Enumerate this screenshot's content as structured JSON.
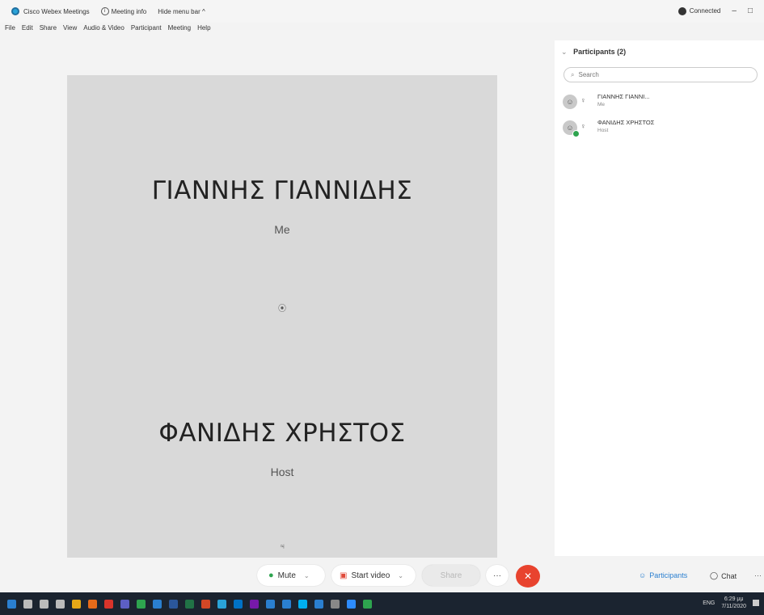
{
  "window": {
    "app_title": "Cisco Webex Meetings",
    "meeting_info": "Meeting info",
    "hide_menu": "Hide menu bar ^",
    "connection_status": "Connected",
    "minimize": "–",
    "maximize": "□"
  },
  "menu": [
    "File",
    "Edit",
    "Share",
    "View",
    "Audio & Video",
    "Participant",
    "Meeting",
    "Help"
  ],
  "stage": {
    "participants": [
      {
        "name": "ΓΙΑΝΝΗΣ ΓΙΑΝΝΙΔΗΣ",
        "role": "Me",
        "icon": "⦿"
      },
      {
        "name": "ΦΑΝΙΔΗΣ ΧΡΗΣΤΟΣ",
        "role": "Host",
        "icon": "♃"
      }
    ]
  },
  "panel": {
    "chevron": "⌄",
    "title": "Participants (2)",
    "search_placeholder": "Search",
    "search_icon": "⌕",
    "avatar_icon": "☺",
    "mic_icon": "♀",
    "list": [
      {
        "name": "ΓΙΑΝΝΗΣ ΓΙΑΝΝΙ...",
        "sub": "Me",
        "host": false
      },
      {
        "name": "ΦΑΝΙΔΗΣ ΧΡΗΣΤΟΣ",
        "sub": "Host",
        "host": true
      }
    ]
  },
  "controls": {
    "mute_icon": "●",
    "mute": "Mute",
    "dropdown_icon": "⌄",
    "video_icon": "▣",
    "start_video": "Start video",
    "share": "Share",
    "more": "···",
    "leave": "✕",
    "participants_icon": "☺",
    "participants": "Participants",
    "chat_icon": "◯",
    "chat": "Chat",
    "more_right": "···"
  },
  "taskbar": {
    "lang": "ENG",
    "time": "6:29 μμ",
    "date": "7/11/2020",
    "icons": [
      "windows",
      "search",
      "cortana",
      "task-view",
      "file-explorer",
      "firefox",
      "opera",
      "teams",
      "chrome",
      "edge",
      "word",
      "excel",
      "powerpoint",
      "webex",
      "outlook",
      "onenote",
      "mail",
      "photos",
      "skype",
      "store",
      "settings",
      "zoom",
      "camera"
    ],
    "colors": [
      "#2a7fd0",
      "#bbbbbb",
      "#bbbbbb",
      "#bbbbbb",
      "#e6a817",
      "#e66b1a",
      "#d9342b",
      "#5c5fc4",
      "#2ea44f",
      "#2a7fd0",
      "#2b579a",
      "#217346",
      "#d24726",
      "#2aa3d8",
      "#0072c6",
      "#7719aa",
      "#2a7fd0",
      "#2a7fd0",
      "#00aff0",
      "#2a7fd0",
      "#888888",
      "#2d8cff",
      "#2ea44f"
    ]
  }
}
